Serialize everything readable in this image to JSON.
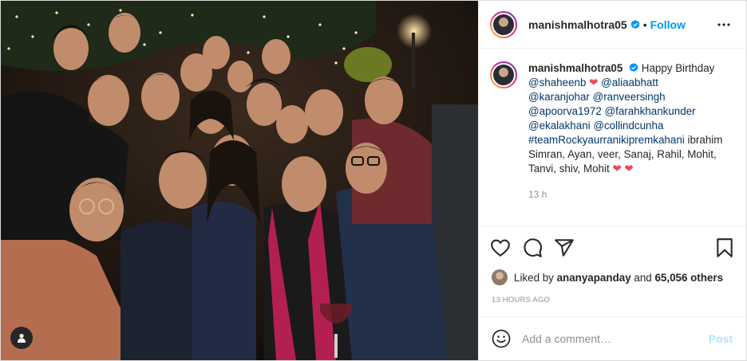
{
  "header": {
    "username": "manishmalhotra05",
    "separator": "•",
    "follow_label": "Follow"
  },
  "caption": {
    "username": "manishmalhotra05",
    "text_start": "Happy Birthday",
    "line1_mention": "@shaheenb",
    "line1_heart": "❤",
    "line1_mention2": "@aliaabhatt",
    "line2_mention1": "@karanjohar",
    "line2_mention2": "@ranveersingh",
    "line3_mention1": "@apoorva1972",
    "line3_mention2": "@farahkhankunder",
    "line4_mention1": "@ekalakhani",
    "line4_mention2": "@collindcunha",
    "hashtag": "#teamRockyaurranikipremkahani",
    "line5_rest": "ibrahim",
    "line6": "Simran, Ayan, veer, Sanaj, Rahil, Mohit,",
    "line7": "Tanvi, shiv, Mohit",
    "line7_hearts": "❤ ❤",
    "time": "13 h"
  },
  "likes": {
    "prefix": "Liked by",
    "liked_by_user": "ananyapanday",
    "connector": "and",
    "others": "65,056 others"
  },
  "date": "13 HOURS AGO",
  "comment": {
    "placeholder": "Add a comment…",
    "post_label": "Post"
  },
  "colors": {
    "accent": "#0095f6",
    "heart": "#ed4956",
    "link": "#00376b",
    "muted": "#8e8e8e",
    "post_disabled": "#b2dffc"
  },
  "icons": {
    "verified": "verified-badge-icon",
    "more": "more-options-icon",
    "like": "heart-outline-icon",
    "comment": "comment-bubble-icon",
    "share": "paper-plane-icon",
    "save": "bookmark-icon",
    "emoji": "emoji-smile-icon",
    "user_tag": "user-tag-icon"
  }
}
